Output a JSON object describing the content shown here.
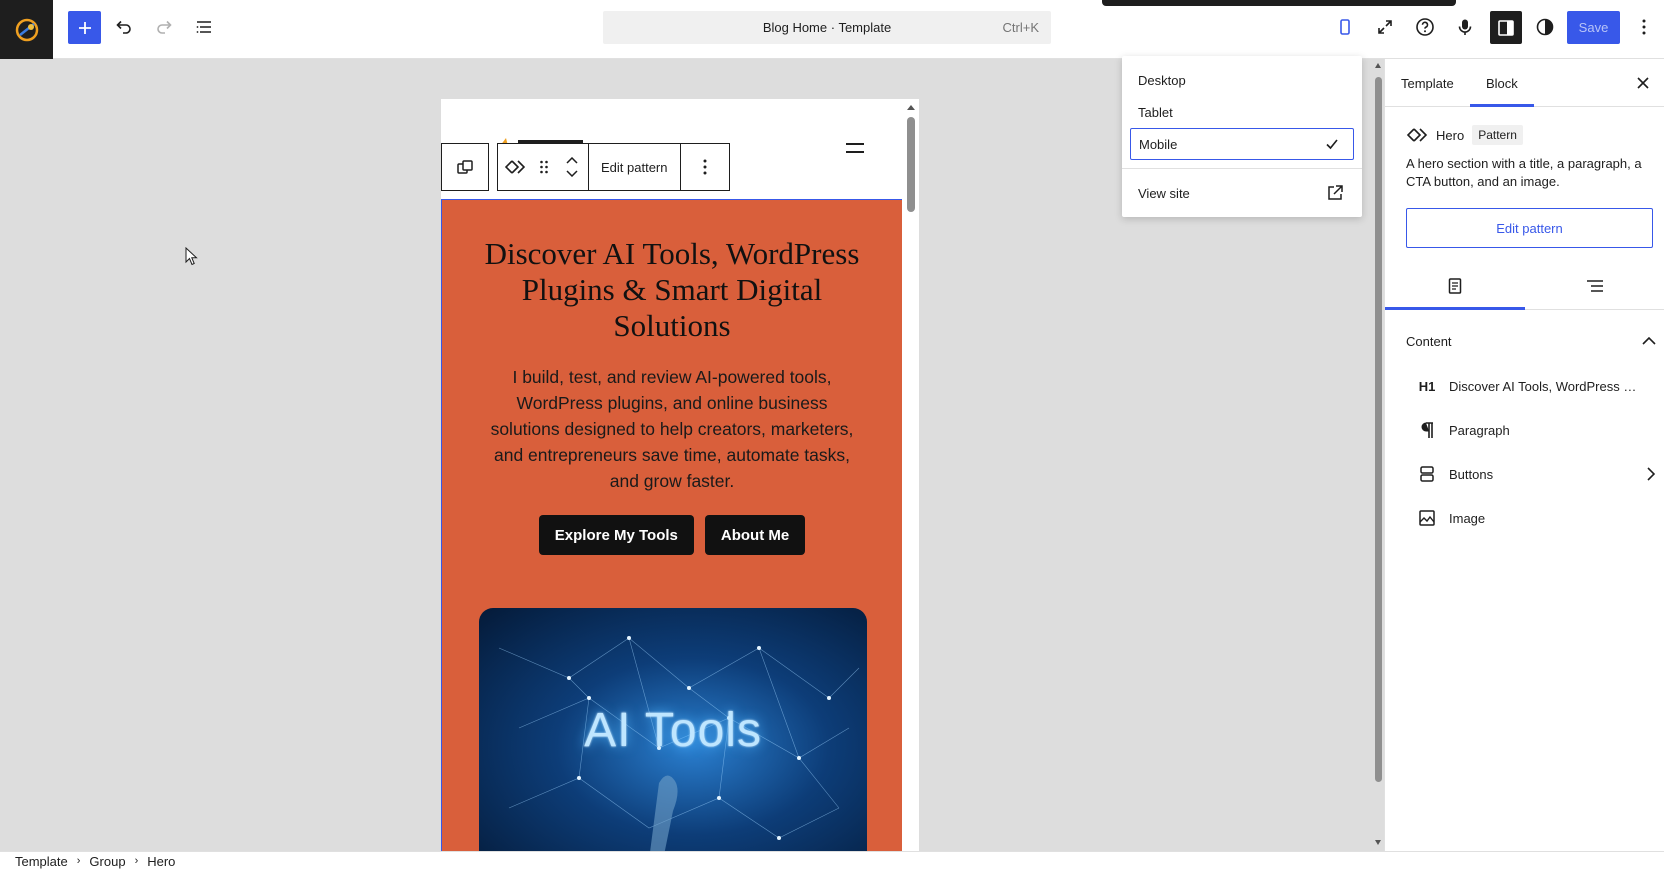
{
  "header": {
    "command_bar": {
      "title": "Blog Home · Template",
      "shortcut": "Ctrl+K"
    },
    "save_label": "Save"
  },
  "preview_menu": {
    "items": [
      {
        "label": "Desktop",
        "selected": false
      },
      {
        "label": "Tablet",
        "selected": false
      },
      {
        "label": "Mobile",
        "selected": true
      }
    ],
    "view_site": "View site"
  },
  "block_toolbar": {
    "edit_pattern": "Edit pattern"
  },
  "hero": {
    "title": "Discover AI Tools, WordPress Plugins & Smart Digital Solutions",
    "paragraph": "I build, test, and review AI-powered tools, WordPress plugins, and online business solutions designed to help creators, marketers, and entrepreneurs save time, automate tasks, and grow faster.",
    "buttons": [
      "Explore My Tools",
      "About Me"
    ],
    "image_text": "AI Tools"
  },
  "sidebar": {
    "tabs": [
      "Template",
      "Block"
    ],
    "active_tab": "Block",
    "block_name": "Hero",
    "block_badge": "Pattern",
    "block_description": "A hero section with a title, a paragraph, a CTA button, and an image.",
    "edit_pattern": "Edit pattern",
    "content_heading": "Content",
    "content_items": [
      {
        "icon": "H1",
        "label": "Discover AI Tools, WordPress Pl..."
      },
      {
        "icon": "paragraph-icon",
        "label": "Paragraph"
      },
      {
        "icon": "buttons-icon",
        "label": "Buttons"
      },
      {
        "icon": "image-icon",
        "label": "Image"
      }
    ]
  },
  "breadcrumb": [
    "Template",
    "Group",
    "Hero"
  ],
  "colors": {
    "accent": "#3858e9",
    "hero_bg": "#d95f3b",
    "canvas_bg": "#dddddd",
    "dark": "#1e1e1e"
  }
}
